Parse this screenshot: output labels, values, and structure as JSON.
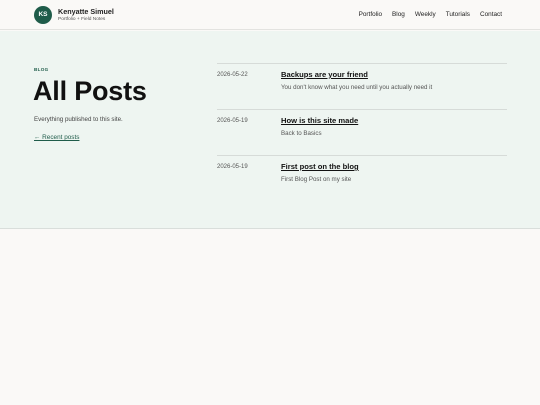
{
  "site": {
    "logo_initials": "KS",
    "name": "Kenyatte Simuel",
    "tagline": "Portfolio + Field Notes"
  },
  "nav": {
    "items": [
      "Portfolio",
      "Blog",
      "Weekly",
      "Tutorials",
      "Contact"
    ]
  },
  "hero": {
    "kicker": "BLOG",
    "title": "All Posts",
    "intro": "Everything published to this site.",
    "back_link": "← Recent posts"
  },
  "posts": [
    {
      "date": "2026-05-22",
      "title": "Backups are your friend",
      "description": "You don't know what you need until you actually need it"
    },
    {
      "date": "2026-05-19",
      "title": "How is this site made",
      "description": "Back to Basics"
    },
    {
      "date": "2026-05-19",
      "title": "First post on the blog",
      "description": "First Blog Post on my site"
    }
  ],
  "colors": {
    "accent": "#1f5c4a",
    "hero_background": "#eef5f1",
    "page_background": "#faf9f7"
  }
}
